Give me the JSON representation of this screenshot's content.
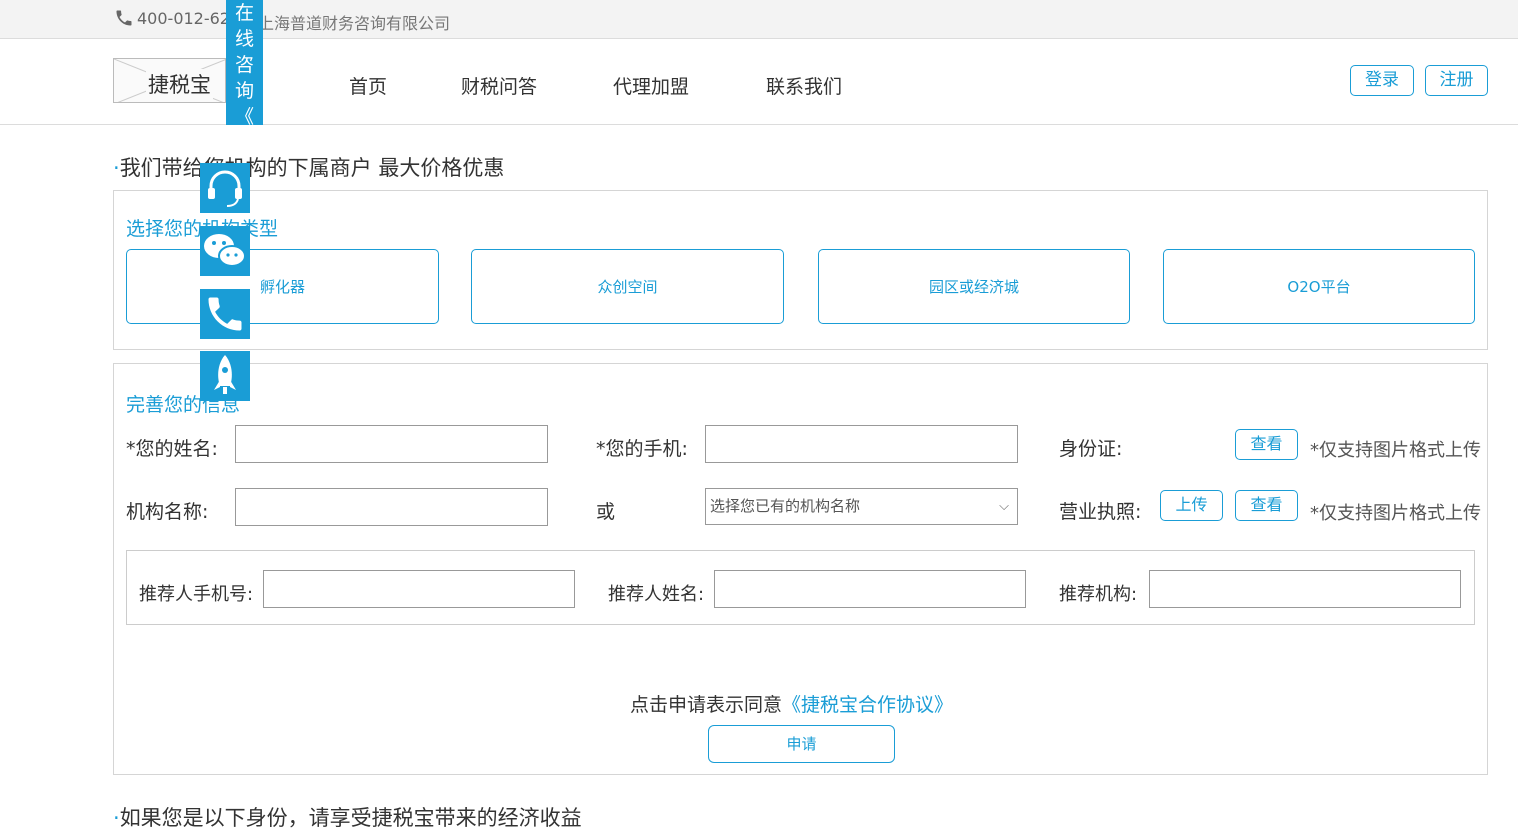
{
  "topbar": {
    "phone": "400-012-62",
    "company": "上海普道财务咨询有限公司"
  },
  "header": {
    "logo_text": "捷税宝",
    "nav": [
      "首页",
      "财税问答",
      "代理加盟",
      "联系我们"
    ],
    "login": "登录",
    "register": "注册"
  },
  "consult": {
    "chars": [
      "在",
      "线",
      "咨",
      "询",
      "《"
    ]
  },
  "side_icons": [
    "headset-icon",
    "wechat-icon",
    "phone-icon",
    "rocket-icon"
  ],
  "section1": {
    "title": "我们带给您机构的下属商户 最大价格优惠",
    "subtitle": "选择您的机构类型",
    "types": [
      "孵化器",
      "众创空间",
      "园区或经济城",
      "O2O平台"
    ]
  },
  "form": {
    "subtitle": "完善您的信息",
    "name_label": "*您的姓名:",
    "mobile_label": "*您的手机:",
    "id_label": "身份证:",
    "org_label": "机构名称:",
    "or_label": "或",
    "org_select": "选择您已有的机构名称",
    "license_label": "营业执照:",
    "view": "查看",
    "upload": "上传",
    "image_hint": "*仅支持图片格式上传",
    "ref_mobile_label": "推荐人手机号:",
    "ref_name_label": "推荐人姓名:",
    "ref_org_label": "推荐机构:",
    "agree_text": "点击申请表示同意",
    "agree_link": "《捷税宝合作协议》",
    "apply": "申请"
  },
  "section2": {
    "title": "如果您是以下身份，请享受捷税宝带来的经济收益"
  },
  "colors": {
    "accent": "#1a9dd6",
    "border": "#d5d5d5"
  }
}
